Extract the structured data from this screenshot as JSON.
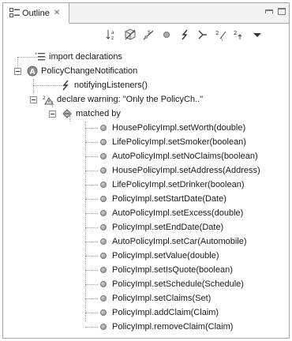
{
  "view": {
    "title": "Outline",
    "close_glyph": "✕"
  },
  "toolbar": [
    {
      "name": "sort-alpha-icon",
      "title": "Sort"
    },
    {
      "name": "hide-fields-icon",
      "title": "Hide Fields"
    },
    {
      "name": "hide-static-icon",
      "title": "Hide Static Members"
    },
    {
      "name": "hide-nonpublic-icon",
      "title": "Hide Non-Public Members"
    },
    {
      "name": "pointcut-icon",
      "title": "Pointcuts"
    },
    {
      "name": "advice-icon",
      "title": "Advice"
    },
    {
      "name": "declare-icon",
      "title": "Declarations"
    },
    {
      "name": "intertype-icon",
      "title": "Inter-type Declarations"
    },
    {
      "name": "view-menu-icon",
      "title": "View Menu"
    }
  ],
  "tree": {
    "imports": "import declarations",
    "aspect": "PolicyChangeNotification",
    "pointcut": "notifyingListeners()",
    "declare": "declare warning: \"Only the PolicyCh..\"",
    "matched_by": "matched by",
    "matches": [
      "HousePolicyImpl.setWorth(double)",
      "LifePolicyImpl.setSmoker(boolean)",
      "AutoPolicyImpl.setNoClaims(boolean)",
      "HousePolicyImpl.setAddress(Address)",
      "LifePolicyImpl.setDrinker(boolean)",
      "PolicyImpl.setStartDate(Date)",
      "AutoPolicyImpl.setExcess(double)",
      "PolicyImpl.setEndDate(Date)",
      "AutoPolicyImpl.setCar(Automobile)",
      "PolicyImpl.setValue(double)",
      "PolicyImpl.setIsQuote(boolean)",
      "PolicyImpl.setSchedule(Schedule)",
      "PolicyImpl.setClaims(Set)",
      "PolicyImpl.addClaim(Claim)",
      "PolicyImpl.removeClaim(Claim)"
    ]
  }
}
